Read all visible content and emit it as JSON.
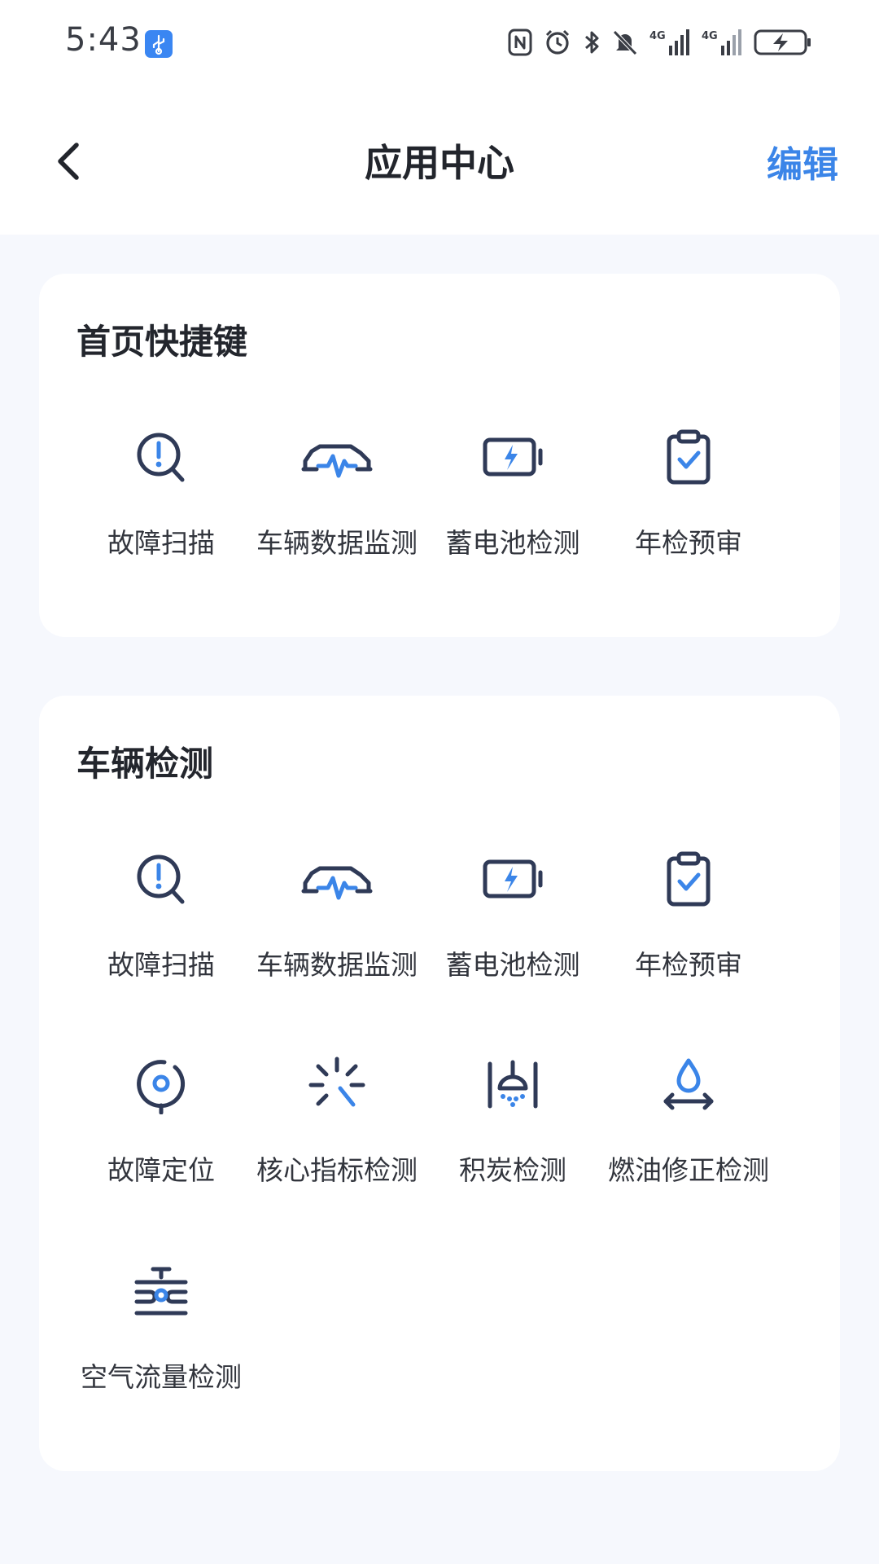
{
  "status_bar": {
    "time": "5:43",
    "icons": [
      "usb-icon",
      "nfc-icon",
      "alarm-icon",
      "bluetooth-icon",
      "mute-icon",
      "4g-signal-icon",
      "4g-signal-icon",
      "battery-charging-icon"
    ]
  },
  "header": {
    "title": "应用中心",
    "edit_label": "编辑"
  },
  "colors": {
    "accent": "#3b85e8",
    "icon_dark": "#2f3a57",
    "icon_blue": "#3b85e8",
    "background": "#f6f8fd"
  },
  "shortcuts": {
    "title": "首页快捷键",
    "items": [
      {
        "label": "故障扫描",
        "icon": "fault-scan-icon"
      },
      {
        "label": "车辆数据监测",
        "icon": "vehicle-data-icon"
      },
      {
        "label": "蓄电池检测",
        "icon": "battery-test-icon"
      },
      {
        "label": "年检预审",
        "icon": "inspection-clipboard-icon"
      }
    ]
  },
  "vehicle_check": {
    "title": "车辆检测",
    "items": [
      {
        "label": "故障扫描",
        "icon": "fault-scan-icon"
      },
      {
        "label": "车辆数据监测",
        "icon": "vehicle-data-icon"
      },
      {
        "label": "蓄电池检测",
        "icon": "battery-test-icon"
      },
      {
        "label": "年检预审",
        "icon": "inspection-clipboard-icon"
      },
      {
        "label": "故障定位",
        "icon": "fault-locate-icon"
      },
      {
        "label": "核心指标检测",
        "icon": "core-metrics-icon"
      },
      {
        "label": "积炭检测",
        "icon": "carbon-deposit-icon"
      },
      {
        "label": "燃油修正检测",
        "icon": "fuel-trim-icon"
      },
      {
        "label": "空气流量检测",
        "icon": "air-flow-icon"
      }
    ]
  }
}
